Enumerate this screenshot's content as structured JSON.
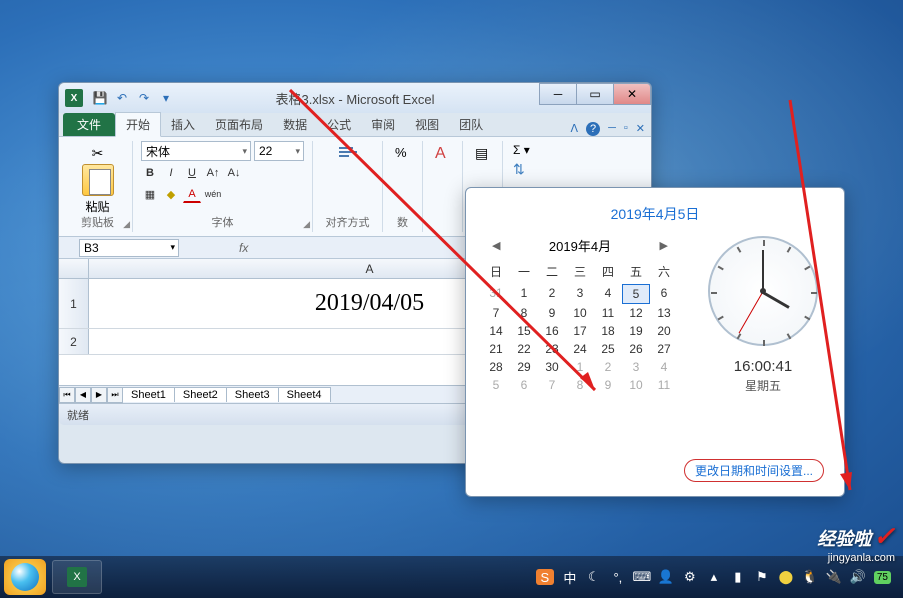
{
  "excel": {
    "title": "表格3.xlsx - Microsoft Excel",
    "qat": {
      "save": "💾",
      "undo": "↶",
      "redo": "↷"
    },
    "tabs": {
      "file": "文件",
      "items": [
        "开始",
        "插入",
        "页面布局",
        "数据",
        "公式",
        "审阅",
        "视图",
        "团队"
      ]
    },
    "ribbon": {
      "paste": "粘贴",
      "clipboard": "剪贴板",
      "font_name": "宋体",
      "font_size": "22",
      "font_label": "字体",
      "align_label": "对齐方式",
      "number_prefix": "数"
    },
    "name_box": "B3",
    "fx": "fx",
    "col_a": "A",
    "row1": "1",
    "row2": "2",
    "cell_a1": "2019/04/05",
    "sheets": [
      "Sheet1",
      "Sheet2",
      "Sheet3",
      "Sheet4"
    ],
    "status": "就绪"
  },
  "calendar": {
    "title": "2019年4月5日",
    "month": "2019年4月",
    "weekdays": [
      "日",
      "一",
      "二",
      "三",
      "四",
      "五",
      "六"
    ],
    "grid": [
      [
        "31",
        "1",
        "2",
        "3",
        "4",
        "5",
        "6"
      ],
      [
        "7",
        "8",
        "9",
        "10",
        "11",
        "12",
        "13"
      ],
      [
        "14",
        "15",
        "16",
        "17",
        "18",
        "19",
        "20"
      ],
      [
        "21",
        "22",
        "23",
        "24",
        "25",
        "26",
        "27"
      ],
      [
        "28",
        "29",
        "30",
        "1",
        "2",
        "3",
        "4"
      ],
      [
        "5",
        "6",
        "7",
        "8",
        "9",
        "10",
        "11"
      ]
    ],
    "time": "16:00:41",
    "day_name": "星期五",
    "change_link": "更改日期和时间设置..."
  },
  "taskbar": {
    "tray_text": "中",
    "battery": "75"
  },
  "watermark": {
    "main": "经验啦",
    "sub": "jingyanla.com"
  }
}
